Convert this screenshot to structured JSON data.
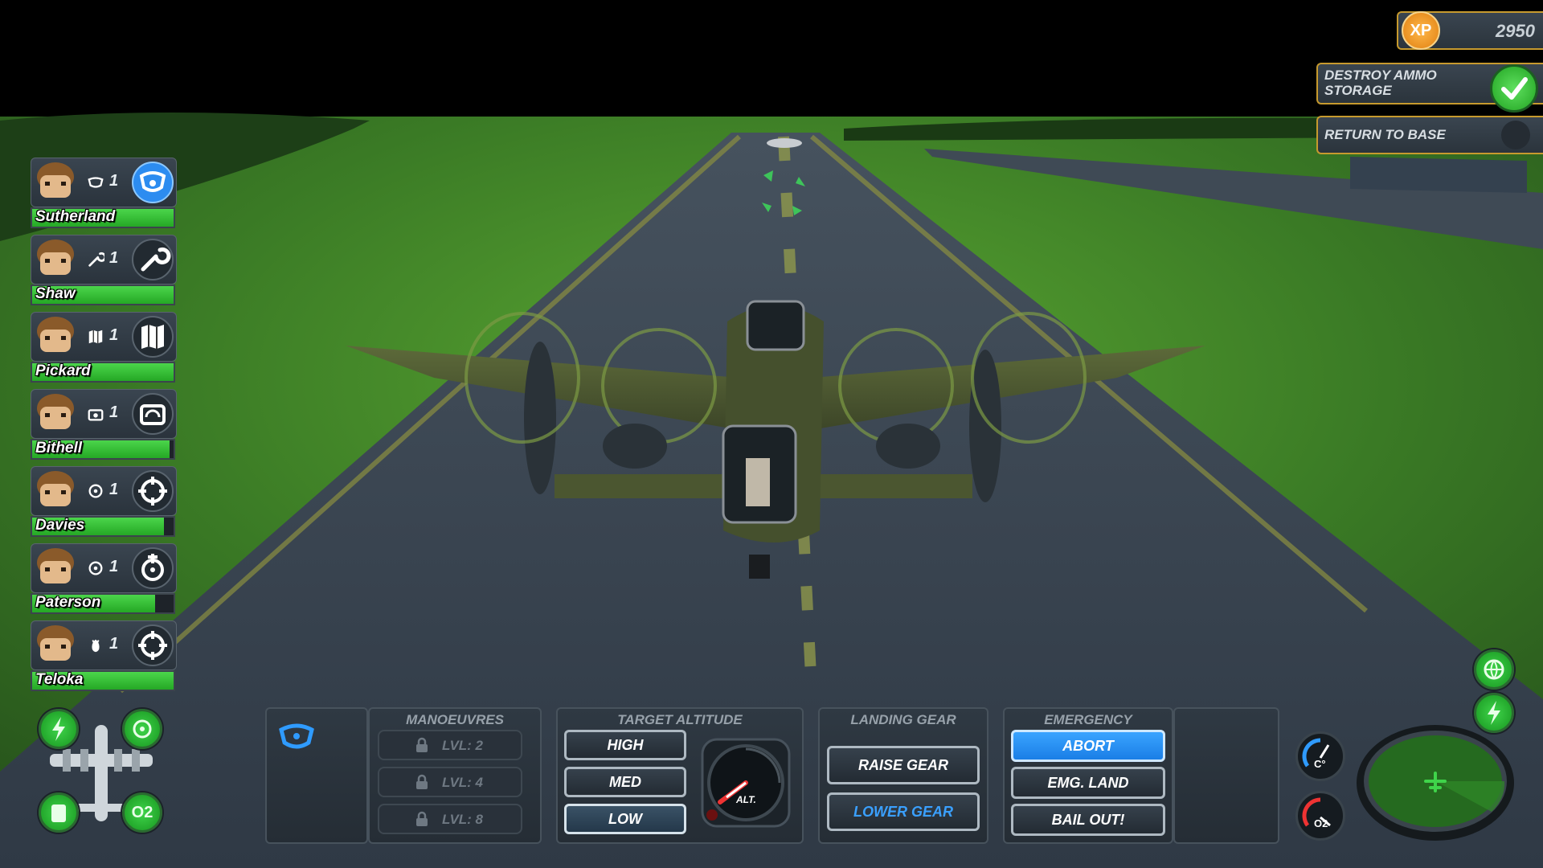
{
  "hud": {
    "xp": {
      "badge": "XP",
      "value": "2950"
    },
    "objectives": [
      {
        "line1": "DESTROY AMMO",
        "line2": "STORAGE",
        "status": "complete"
      },
      {
        "line1": "RETURN TO BASE",
        "line2": "",
        "status": "pending"
      }
    ]
  },
  "crew": [
    {
      "name": "Sutherland",
      "level": "1",
      "role_icon": "steering-wheel-icon",
      "health": 1.0,
      "active": true
    },
    {
      "name": "Shaw",
      "level": "1",
      "role_icon": "wrench-icon",
      "health": 1.0,
      "active": false
    },
    {
      "name": "Pickard",
      "level": "1",
      "role_icon": "map-icon",
      "health": 1.0,
      "active": false
    },
    {
      "name": "Bithell",
      "level": "1",
      "role_icon": "radio-icon",
      "health": 0.97,
      "active": false
    },
    {
      "name": "Davies",
      "level": "1",
      "role_icon": "crosshair-icon",
      "health": 0.93,
      "active": false
    },
    {
      "name": "Paterson",
      "level": "1",
      "role_icon": "crosshair-icon",
      "health": 0.87,
      "active": false
    },
    {
      "name": "Teloka",
      "level": "1",
      "role_icon": "crosshair-icon",
      "health": 1.0,
      "active": false
    }
  ],
  "panels": {
    "manoeuvres": {
      "title": "MANOEUVRES",
      "locked": [
        "LVL: 2",
        "LVL: 4",
        "LVL: 8"
      ]
    },
    "altitude": {
      "title": "TARGET ALTITUDE",
      "options": [
        "HIGH",
        "MED",
        "LOW"
      ],
      "selected": "LOW",
      "gauge_label": "ALT."
    },
    "landing_gear": {
      "title": "LANDING GEAR",
      "raise": "RAISE GEAR",
      "lower": "LOWER GEAR"
    },
    "emergency": {
      "title": "EMERGENCY",
      "abort": "ABORT",
      "land": "EMG. LAND",
      "bail": "BAIL OUT!"
    }
  },
  "gauges": {
    "temp_label": "C°",
    "oxygen_label": "O2"
  },
  "plane_status": {
    "oxygen_label": "O2"
  },
  "colors": {
    "accent_blue": "#2c8cf0",
    "health_green": "#3cc83c",
    "gold": "#c79a2e",
    "grass": "#2f6a22"
  }
}
